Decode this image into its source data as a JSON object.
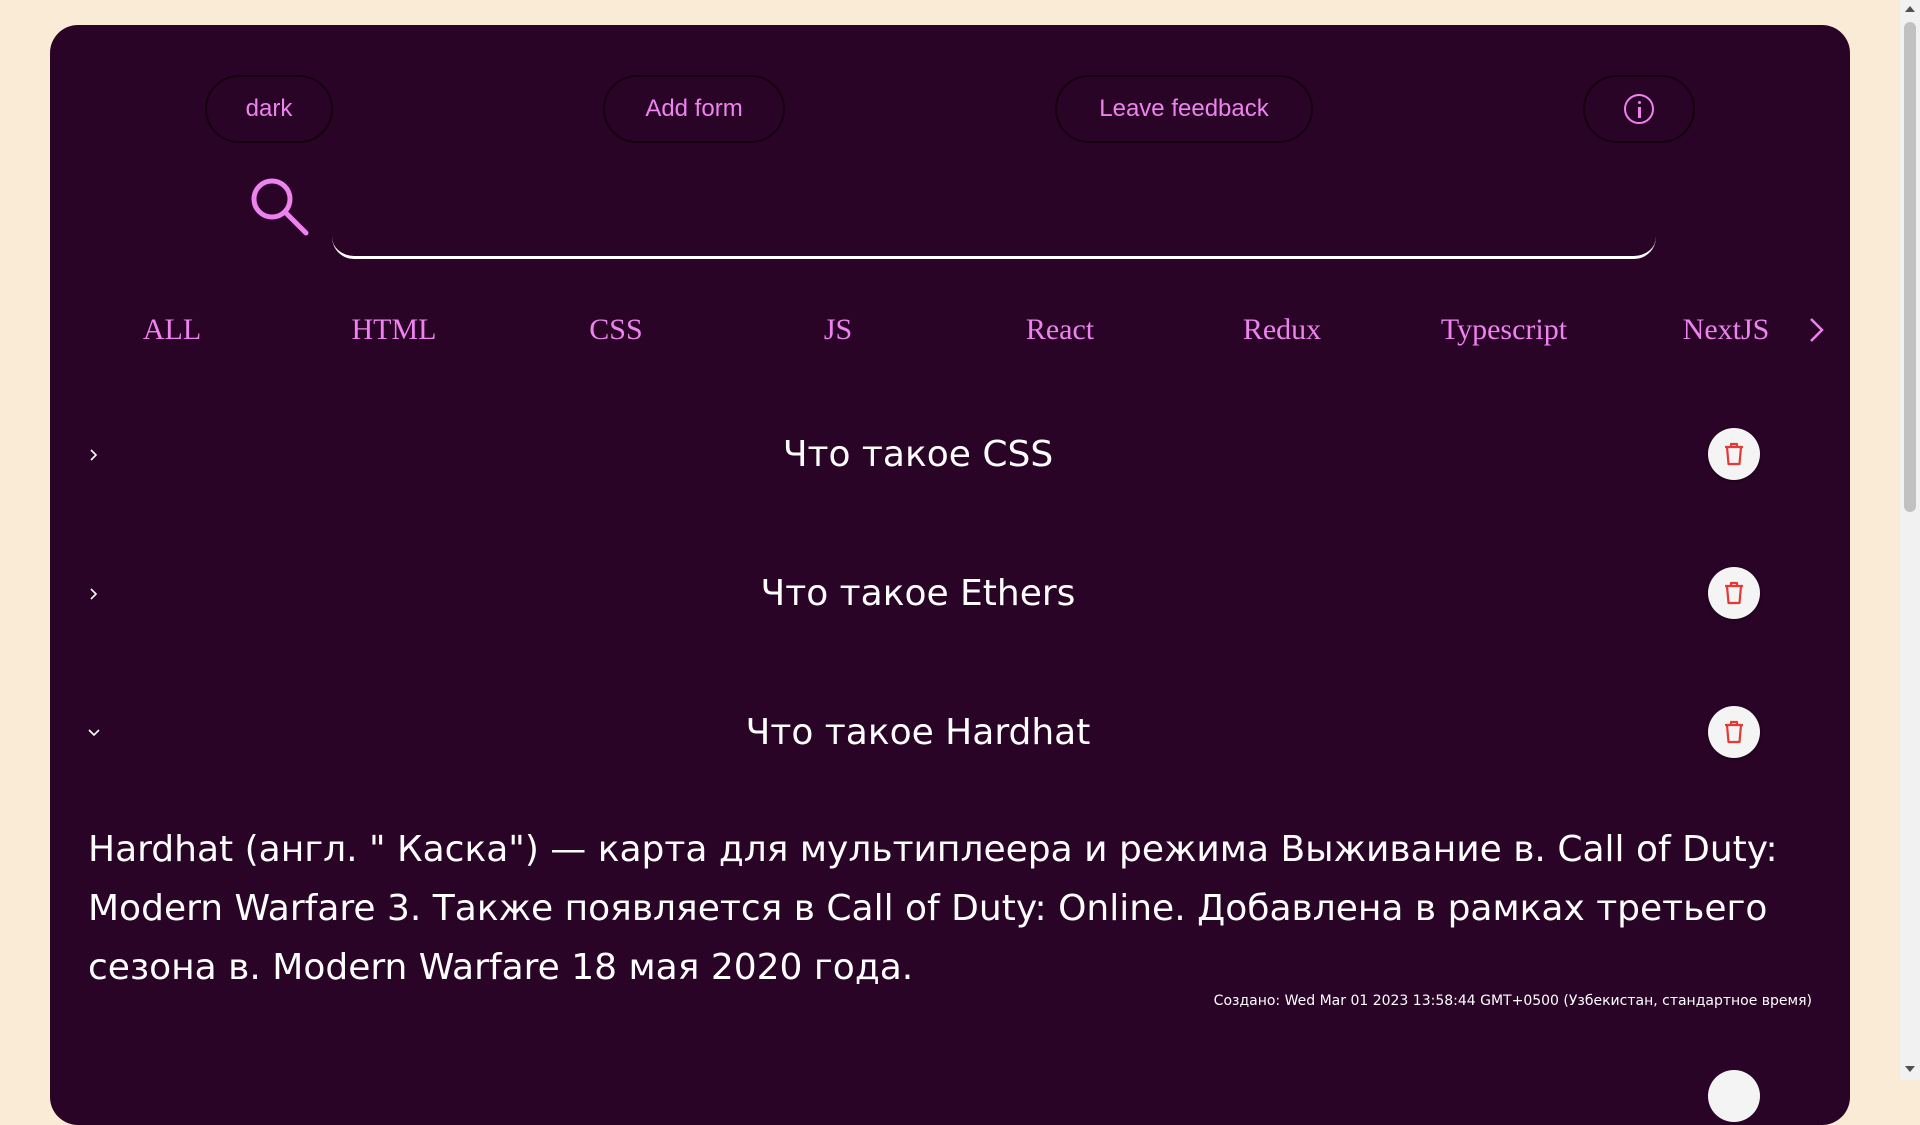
{
  "header": {
    "theme_button": "dark",
    "add_form_button": "Add form",
    "feedback_button": "Leave feedback",
    "info_icon": "info-circle-icon"
  },
  "search": {
    "value": "",
    "placeholder": "",
    "icon": "search-icon"
  },
  "categories": [
    "ALL",
    "HTML",
    "CSS",
    "JS",
    "React",
    "Redux",
    "Typescript",
    "NextJS"
  ],
  "faq": [
    {
      "title": "Что такое CSS",
      "expanded": false
    },
    {
      "title": "Что такое Ethers",
      "expanded": false
    },
    {
      "title": "Что такое Hardhat",
      "expanded": true,
      "answer": "Hardhat (англ. \" Каска\") — карта для мультиплеера и режима Выживание в. Call of Duty: Modern Warfare 3. Также появляется в Call of Duty: Online. Добавлена в рамках третьего сезона в. Modern Warfare 18 мая 2020 года.",
      "created": "Создано: Wed Mar 01 2023 13:58:44 GMT+0500 (Узбекистан, стандартное время)"
    }
  ],
  "colors": {
    "background": "#faebd7",
    "card": "#2a0427",
    "accent": "#ee82ee",
    "text": "#ffffff",
    "delete_icon": "#e53935"
  }
}
